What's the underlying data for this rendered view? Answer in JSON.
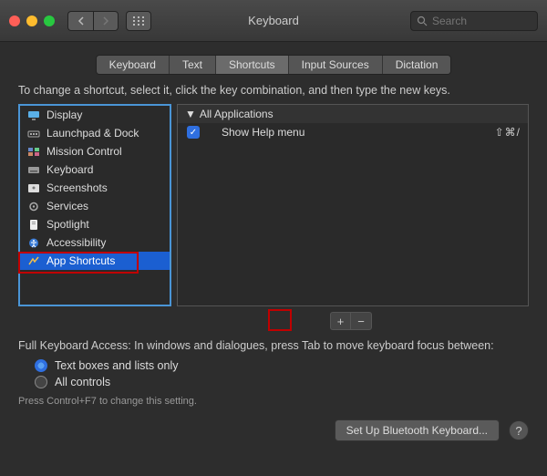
{
  "window": {
    "title": "Keyboard",
    "search_placeholder": "Search"
  },
  "tabs": [
    {
      "label": "Keyboard",
      "active": false
    },
    {
      "label": "Text",
      "active": false
    },
    {
      "label": "Shortcuts",
      "active": true
    },
    {
      "label": "Input Sources",
      "active": false
    },
    {
      "label": "Dictation",
      "active": false
    }
  ],
  "instruction": "To change a shortcut, select it, click the key combination, and then type the new keys.",
  "categories": [
    {
      "icon": "display-icon",
      "label": "Display"
    },
    {
      "icon": "launchpad-icon",
      "label": "Launchpad & Dock"
    },
    {
      "icon": "mission-control-icon",
      "label": "Mission Control"
    },
    {
      "icon": "keyboard-icon",
      "label": "Keyboard"
    },
    {
      "icon": "screenshots-icon",
      "label": "Screenshots"
    },
    {
      "icon": "services-icon",
      "label": "Services"
    },
    {
      "icon": "spotlight-icon",
      "label": "Spotlight"
    },
    {
      "icon": "accessibility-icon",
      "label": "Accessibility"
    },
    {
      "icon": "app-shortcuts-icon",
      "label": "App Shortcuts",
      "selected": true
    }
  ],
  "shortcut_group": {
    "header": "All Applications",
    "items": [
      {
        "checked": true,
        "label": "Show Help menu",
        "keys": "⇧⌘/"
      }
    ]
  },
  "addremove": {
    "add": "+",
    "remove": "−"
  },
  "full_keyboard_access": {
    "text": "Full Keyboard Access: In windows and dialogues, press Tab to move keyboard focus between:",
    "options": [
      {
        "label": "Text boxes and lists only",
        "selected": true
      },
      {
        "label": "All controls",
        "selected": false
      }
    ],
    "hint": "Press Control+F7 to change this setting."
  },
  "footer": {
    "button": "Set Up Bluetooth Keyboard...",
    "help": "?"
  }
}
